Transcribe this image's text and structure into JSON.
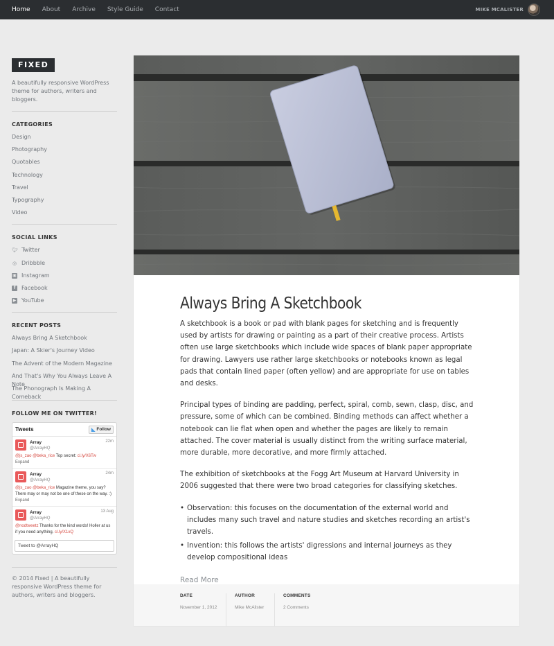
{
  "topnav": {
    "items": [
      {
        "label": "Home",
        "active": true
      },
      {
        "label": "About"
      },
      {
        "label": "Archive"
      },
      {
        "label": "Style Guide"
      },
      {
        "label": "Contact"
      }
    ],
    "user_name": "MIKE MCALISTER"
  },
  "sidebar": {
    "logo": "FIXED",
    "tagline": "A beautifully responsive WordPress theme for authors, writers and bloggers.",
    "categories": {
      "heading": "CATEGORIES",
      "items": [
        "Design",
        "Photography",
        "Quotables",
        "Technology",
        "Travel",
        "Typography",
        "Video"
      ]
    },
    "social": {
      "heading": "SOCIAL LINKS",
      "items": [
        {
          "label": "Twitter",
          "icon": "twitter-icon"
        },
        {
          "label": "Dribbble",
          "icon": "dribbble-icon"
        },
        {
          "label": "Instagram",
          "icon": "instagram-icon"
        },
        {
          "label": "Facebook",
          "icon": "facebook-icon"
        },
        {
          "label": "YouTube",
          "icon": "youtube-icon"
        }
      ]
    },
    "recent": {
      "heading": "RECENT POSTS",
      "items": [
        "Always Bring A Sketchbook",
        "Japan: A Skier's Journey Video",
        "The Advent of the Modern Magazine",
        "And That's Why You Always Leave A Note",
        "The Phonograph Is Making A Comeback"
      ]
    },
    "twitter": {
      "heading": "FOLLOW ME ON TWITTER!",
      "widget_title": "Tweets",
      "follow_label": "Follow",
      "tweets": [
        {
          "name": "Array",
          "handle": "@ArrayHQ",
          "time": "22m",
          "mentions": "@js_zao @beka_rice",
          "text": " Top secret: ",
          "link": "cl.ly/X6Tw",
          "expand": "Expand"
        },
        {
          "name": "Array",
          "handle": "@ArrayHQ",
          "time": "24m",
          "mentions": "@js_zao @beka_rice",
          "text": " Magazine theme, you say? There may or may not be one of these on the way. :)",
          "link": "",
          "expand": "Expand"
        },
        {
          "name": "Array",
          "handle": "@ArrayHQ",
          "time": "13 Aug",
          "mentions": "@nodtweetz",
          "text": " Thanks for the kind words! Holler at us if you need anything. ",
          "link": "cl.ly/X1xQ",
          "expand": ""
        }
      ],
      "compose_placeholder": "Tweet to @ArrayHQ"
    },
    "copyright": "© 2014 Fixed | A beautifully responsive WordPress theme for authors, writers and bloggers."
  },
  "post": {
    "title": "Always Bring A Sketchbook",
    "paragraphs": [
      "A sketchbook is a book or pad with blank pages for sketching and is frequently used by artists for drawing or painting as a part of their creative process. Artists often use large sketchbooks which include wide spaces of blank paper appropriate for drawing. Lawyers use rather large sketchbooks or notebooks known as legal pads that contain lined paper (often yellow) and are appropriate for use on tables and desks.",
      "Principal types of binding are padding, perfect, spiral, comb, sewn, clasp, disc, and pressure, some of which can be combined. Binding methods can affect whether a notebook can lie flat when open and whether the pages are likely to remain attached. The cover material is usually distinct from the writing surface material, more durable, more decorative, and more firmly attached.",
      "The exhibition of sketchbooks at the Fogg Art Museum at Harvard University in 2006 suggested that there were two broad categories for classifying sketches."
    ],
    "bullets": [
      "Observation: this focuses on the documentation of the external world and includes many such travel and nature studies and sketches recording an artist's travels.",
      "Invention: this follows the artists' digressions and internal journeys as they develop compositional ideas"
    ],
    "read_more": "Read More",
    "meta": {
      "date_label": "DATE",
      "date_value": "November 1, 2012",
      "author_label": "AUTHOR",
      "author_value": "Mike McAlister",
      "comments_label": "COMMENTS",
      "comments_value": "2 Comments"
    }
  }
}
